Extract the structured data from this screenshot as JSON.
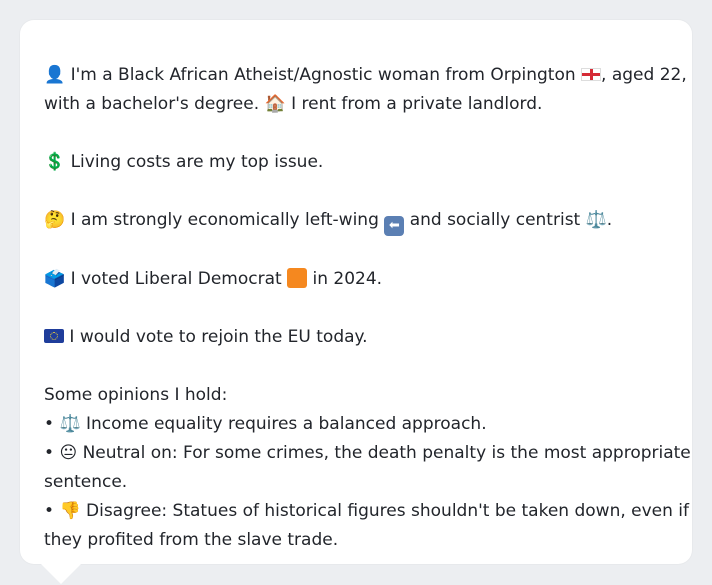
{
  "profile": {
    "line1": {
      "icon": "👤",
      "text_a": "I'm a Black African Atheist/Agnostic woman from Orpington",
      "text_b": ", aged 22,"
    },
    "line2": {
      "text_a": "with a bachelor's degree.",
      "icon": "🏠",
      "text_b": "I rent from a private landlord."
    },
    "issue": {
      "icon": "💲",
      "text": "Living costs are my top issue."
    },
    "ideology": {
      "icon": "🤔",
      "text_a": "I am strongly economically left-wing",
      "arrow": "⬅",
      "text_b": "and socially centrist",
      "scale": "⚖️",
      "text_c": "."
    },
    "vote": {
      "icon": "🗳️",
      "text_a": "I voted Liberal Democrat",
      "text_b": "in 2024."
    },
    "eu": {
      "text": "I would vote to rejoin the EU today."
    },
    "opinions_heading": "Some opinions I hold:",
    "opinions": [
      {
        "bullet": "•",
        "icon": "⚖️",
        "line1": "Income equality requires a balanced approach.",
        "line2": ""
      },
      {
        "bullet": "•",
        "icon": "😐",
        "line1": "Neutral on: For some crimes, the death penalty is the most appropriate",
        "line2": "sentence."
      },
      {
        "bullet": "•",
        "icon": "👎",
        "line1": "Disagree: Statues of historical figures shouldn't be taken down, even if",
        "line2": "they profited from the slave trade."
      }
    ]
  },
  "colors": {
    "background": "#eceef1",
    "card": "#ffffff",
    "text": "#22252b",
    "lib_dem_orange": "#f5881f"
  }
}
